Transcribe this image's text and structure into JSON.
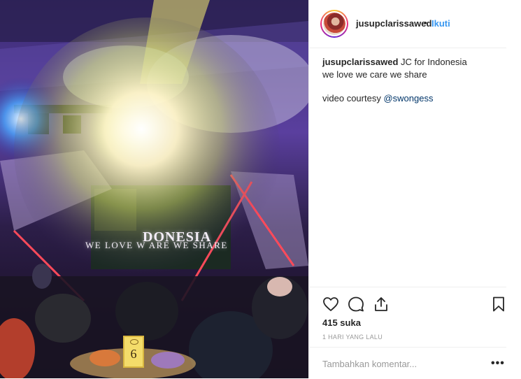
{
  "media": {
    "screen_title": "DONESIA",
    "screen_subtitle": "WE LOVE  W  ARE  WE SHARE",
    "table_number": "6"
  },
  "post": {
    "username": "jusupclarissawed",
    "separator": "•",
    "follow_label": "Ikuti",
    "caption_user": "jusupclarissawed",
    "caption_text": "JC for Indonesia",
    "caption_line2": "we love we care we share",
    "caption_courtesy": "video courtesy ",
    "caption_mention": "@swongess",
    "likes": "415 suka",
    "timestamp": "1 HARI YANG LALU",
    "comment_placeholder": "Tambahkan komentar...",
    "more_options": "•••"
  },
  "icons": {
    "like": "heart-icon",
    "comment": "comment-icon",
    "share": "share-icon",
    "save": "bookmark-icon"
  }
}
